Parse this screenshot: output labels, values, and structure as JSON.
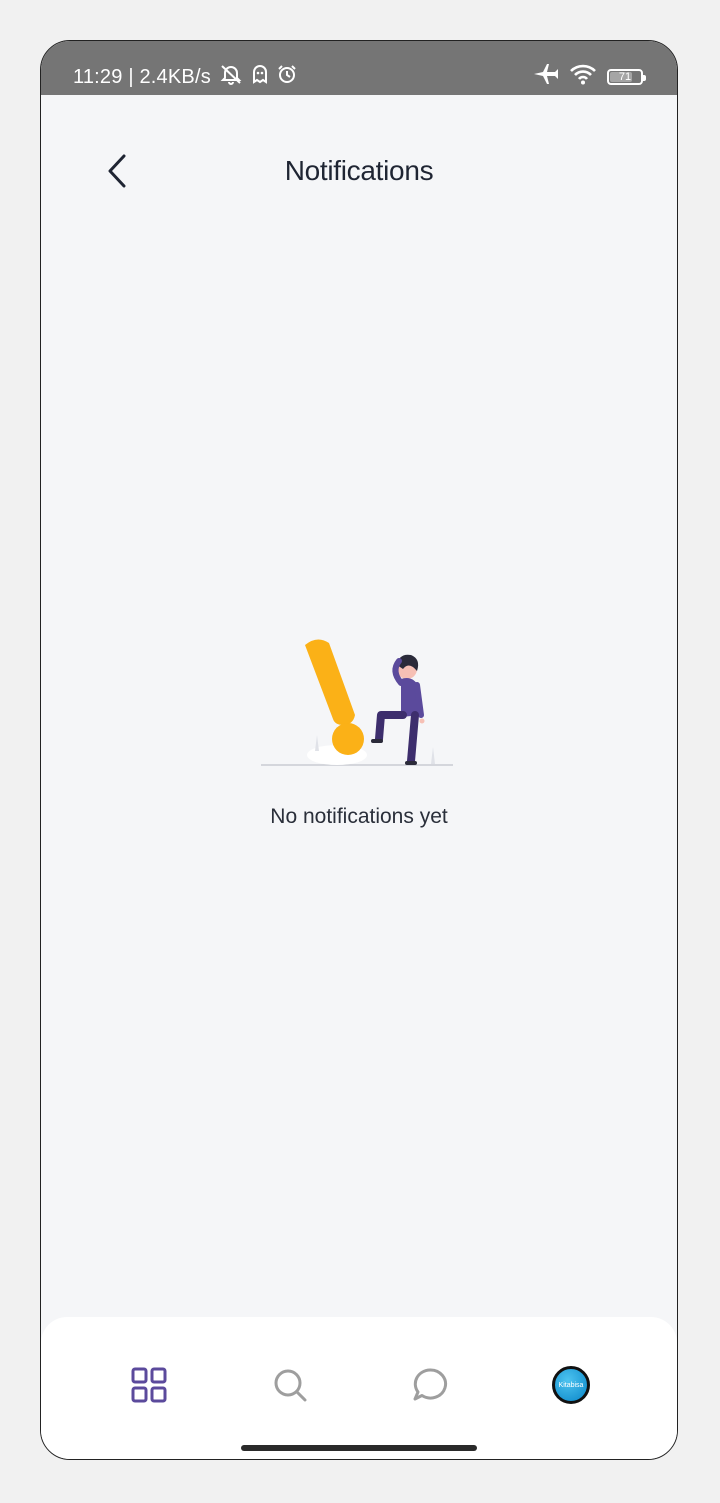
{
  "status_bar": {
    "text": "11:29 | 2.4KB/s",
    "battery_level": "71",
    "icons_left": [
      "muted-bell-icon",
      "ghost-icon",
      "alarm-icon"
    ],
    "icons_right": [
      "airplane-icon",
      "wifi-icon",
      "battery-icon"
    ]
  },
  "header": {
    "title": "Notifications",
    "back_icon": "chevron-left-icon"
  },
  "empty_state": {
    "message": "No notifications yet",
    "illustration": "exclamation-person-illustration",
    "accent_color": "#FBB117",
    "figure_color": "#5B4A9C"
  },
  "bottom_nav": {
    "items": [
      {
        "icon": "grid-icon",
        "active": true
      },
      {
        "icon": "search-icon",
        "active": false
      },
      {
        "icon": "chat-bubble-icon",
        "active": false
      },
      {
        "icon": "avatar",
        "label": "Kitabisa",
        "active": false
      }
    ],
    "active_color": "#5B4A9C",
    "inactive_color": "#9E9E9E"
  }
}
